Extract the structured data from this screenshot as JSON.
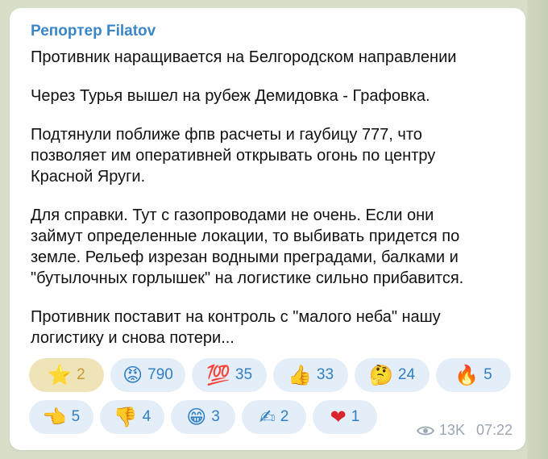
{
  "post": {
    "channel": "Репортер Filatov",
    "paragraphs": [
      "Противник наращивается на Белгородском направлении",
      "Через Турья вышел на рубеж Демидовка - Графовка.",
      "Подтянули поближе фпв расчеты и гаубицу 777, что\nпозволяет им оперативней открывать огонь по центру\nКрасной Яруги.",
      "Для справки. Тут с газопроводами не очень. Если они\nзаймут определенные локации, то выбивать придется по\nземле. Рельеф изрезан водными преградами, балками и\n\"бутылочных горлышек\" на логистике сильно прибавится.",
      "Противник поставит на контроль с \"малого неба\" нашу\nлогистику и снова потери..."
    ],
    "views": "13K",
    "time": "07:22"
  },
  "reactions": {
    "row1": [
      {
        "icon": "star-emoji",
        "emoji": "⭐",
        "count": "2",
        "selected": true
      },
      {
        "icon": "angry-face-emoji",
        "emoji": "😡",
        "count": "790"
      },
      {
        "icon": "hundred-points-emoji",
        "emoji": "💯",
        "count": "35"
      },
      {
        "icon": "thumbs-up-emoji",
        "emoji": "👍",
        "count": "33"
      },
      {
        "icon": "thinking-face-emoji",
        "emoji": "🤔",
        "count": "24"
      },
      {
        "icon": "fire-emoji",
        "emoji": "🔥",
        "count": "5"
      }
    ],
    "row2": [
      {
        "icon": "pointing-left-emoji",
        "emoji": "👈",
        "count": "5"
      },
      {
        "icon": "thumbs-down-emoji",
        "emoji": "👎",
        "count": "4"
      },
      {
        "icon": "grinning-face-emoji",
        "emoji": "😁",
        "count": "3"
      },
      {
        "icon": "writing-hand-emoji",
        "emoji": "✍",
        "count": "2"
      },
      {
        "icon": "red-heart-emoji",
        "emoji": "❤",
        "count": "1"
      }
    ]
  },
  "colors": {
    "link": "#3a86c8",
    "chip_bg": "#e4eef8",
    "chip_selected_bg": "#efe4b8",
    "meta": "#9aa6b2"
  }
}
